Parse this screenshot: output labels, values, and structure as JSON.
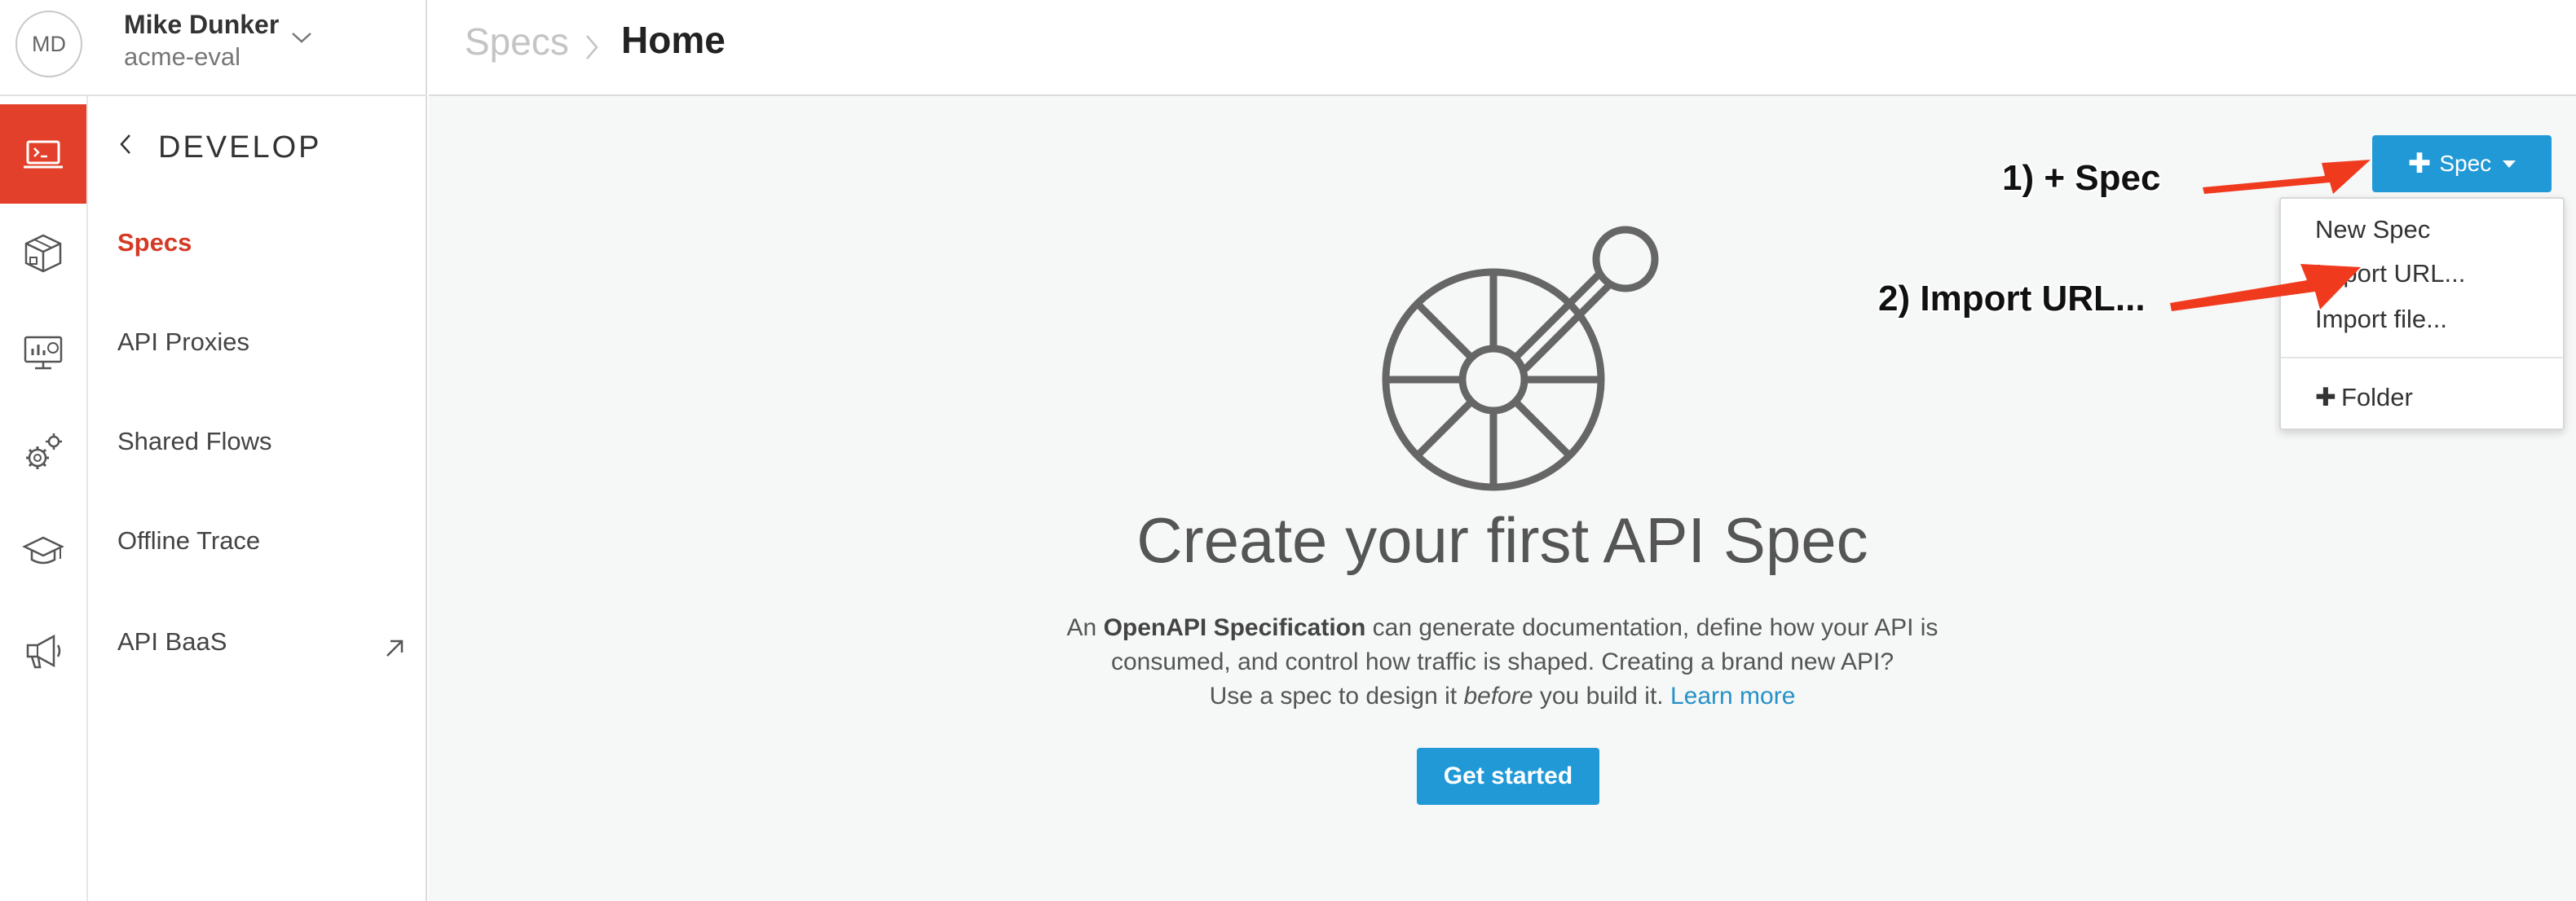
{
  "user": {
    "initials": "MD",
    "name": "Mike Dunker",
    "org": "acme-eval"
  },
  "breadcrumb": {
    "parent": "Specs",
    "current": "Home"
  },
  "nav": {
    "heading": "DEVELOP",
    "items": [
      {
        "label": "Specs"
      },
      {
        "label": "API Proxies"
      },
      {
        "label": "Shared Flows"
      },
      {
        "label": "Offline Trace"
      },
      {
        "label": "API BaaS"
      }
    ]
  },
  "rail_icons": [
    "develop-icon",
    "publish-icon",
    "analyze-icon",
    "admin-icon",
    "learn-icon",
    "announce-icon"
  ],
  "toolbar": {
    "spec_plus": "✚",
    "spec_label": "Spec"
  },
  "dropdown": {
    "new_spec": "New Spec",
    "import_url": "Import URL...",
    "import_file": "Import file...",
    "folder_plus": "✚",
    "folder": "Folder"
  },
  "annotations": {
    "step1": "1) + Spec",
    "step2": "2) Import URL..."
  },
  "empty_state": {
    "title": "Create your first API Spec",
    "body_1": "An ",
    "body_bold": "OpenAPI Specification",
    "body_2": " can generate documentation, define how your API is",
    "body_line2": "consumed, and control how traffic is shaped. Creating a brand new API?",
    "body_line3a": "Use a spec to design it ",
    "body_line3_italic": "before",
    "body_line3b": " you build it. ",
    "learn_more": "Learn more",
    "cta": "Get started"
  },
  "colors": {
    "accent_red": "#e2402a",
    "primary_blue": "#2199d6",
    "link_blue": "#2592c7",
    "annotation_arrow": "#f03a1e"
  }
}
